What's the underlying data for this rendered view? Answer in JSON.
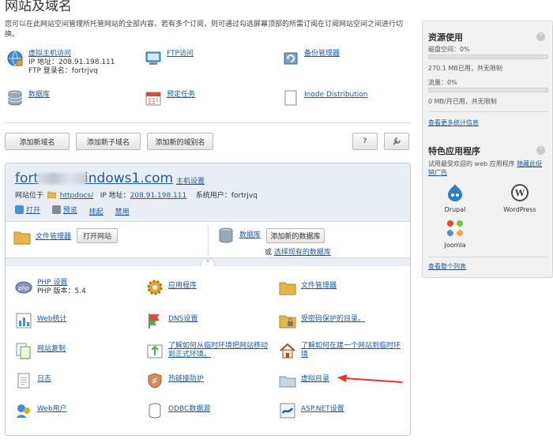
{
  "page": {
    "title": "网站及域名",
    "intro": "您可以在此网站空间管理所托管网站的全部内容。若有多个订阅，则可通过勾选屏幕顶部的所需订阅在订阅网站空间之间进行切换。"
  },
  "tools": {
    "hosting": {
      "label": "虚拟主机访问",
      "ip": "IP 地址：208.91.198.111",
      "ftp": "FTP 登录名：fortrjvq"
    },
    "ftp": "FTP访问",
    "backup": "备份管理器",
    "database": "数据库",
    "scheduled": "预定任务",
    "inode": "Inode Distribution"
  },
  "buttons": {
    "add_domain": "添加新域名",
    "add_subdomain": "添加新子域名",
    "add_alias": "添加新的域别名",
    "help": "?"
  },
  "domain": {
    "name_prefix": "fort",
    "name_suffix": "indows1.com",
    "host_settings": "主机设置",
    "located_label": "网站位于",
    "docroot": "httpdocs/",
    "ip_label": "IP 地址：",
    "ip": "208.91.198.111",
    "sysuser": "系统用户：fortrjvq",
    "actions": [
      "打开",
      "预览",
      "挂起",
      "禁用"
    ],
    "file_manager": "文件管理器",
    "open_site": "打开网站",
    "db_label": "数据库",
    "add_db": "添加新的数据库",
    "or": "或",
    "select_db": "选择现有的数据库",
    "collapse": "^"
  },
  "features": [
    {
      "label": "PHP 设置",
      "sub": "PHP 版本：5.4"
    },
    {
      "label": "应用程序"
    },
    {
      "label": "文件管理器"
    },
    {
      "label": "Web统计"
    },
    {
      "label": "DNS设置"
    },
    {
      "label": "受密码保护的目录。"
    },
    {
      "label": "网站复制"
    },
    {
      "label": "了解如何从临时环境把网站移动到正式环境。"
    },
    {
      "label": "了解如何在建一个网站到临时环境"
    },
    {
      "label": "日志"
    },
    {
      "label": "热链接防护"
    },
    {
      "label": "虚拟目录"
    },
    {
      "label": "Web用户"
    },
    {
      "label": "ODBC数据源"
    },
    {
      "label": "ASP.NET设置"
    }
  ],
  "sidebar": {
    "resources": {
      "title": "资源使用",
      "disk_label": "磁盘空间：0%",
      "disk_fraction": 0,
      "disk_detail": "270.1 MB已用，共无限制",
      "traffic_label": "流量：0%",
      "traffic_fraction": 0,
      "traffic_detail": "0 MB/月已用，共无限制",
      "more": "查看更多统计信息"
    },
    "apps": {
      "title": "特色应用程序",
      "desc_prefix": "试用最受欢迎的 web 应用程序",
      "desc_link": "隐藏此促销广告",
      "items": [
        "Drupal",
        "WordPress",
        "Joomla"
      ],
      "all": "查看整个列表"
    }
  },
  "colors": {
    "link": "#1a5ba8",
    "panel": "#e9eef5",
    "arrow": "#e8322b"
  }
}
